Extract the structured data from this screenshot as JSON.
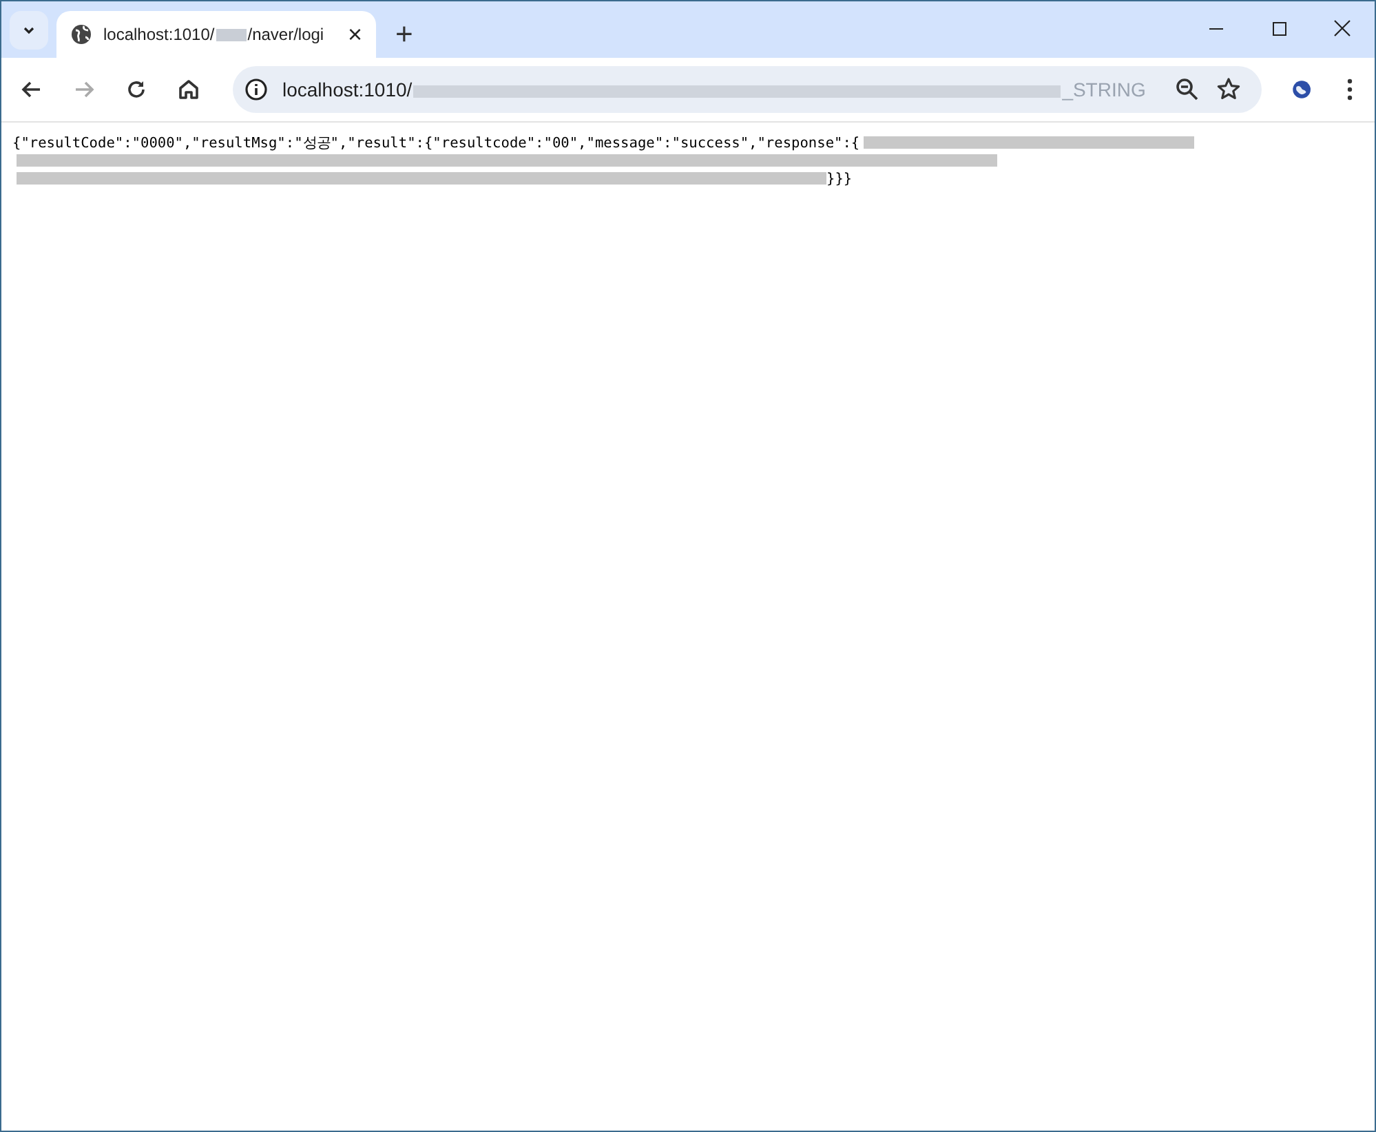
{
  "tab": {
    "title_start": "localhost:1010/",
    "title_end": "/naver/logi",
    "close": "×"
  },
  "new_tab": "+",
  "address_bar": {
    "host": "localhost:1010/",
    "tail": "_STRING"
  },
  "body": {
    "line_1": "{\"resultCode\":\"0000\",\"resultMsg\":\"성공\",\"result\":{\"resultcode\":\"00\",\"message\":\"success\",\"response\":{",
    "line_3_end": "}}}"
  }
}
